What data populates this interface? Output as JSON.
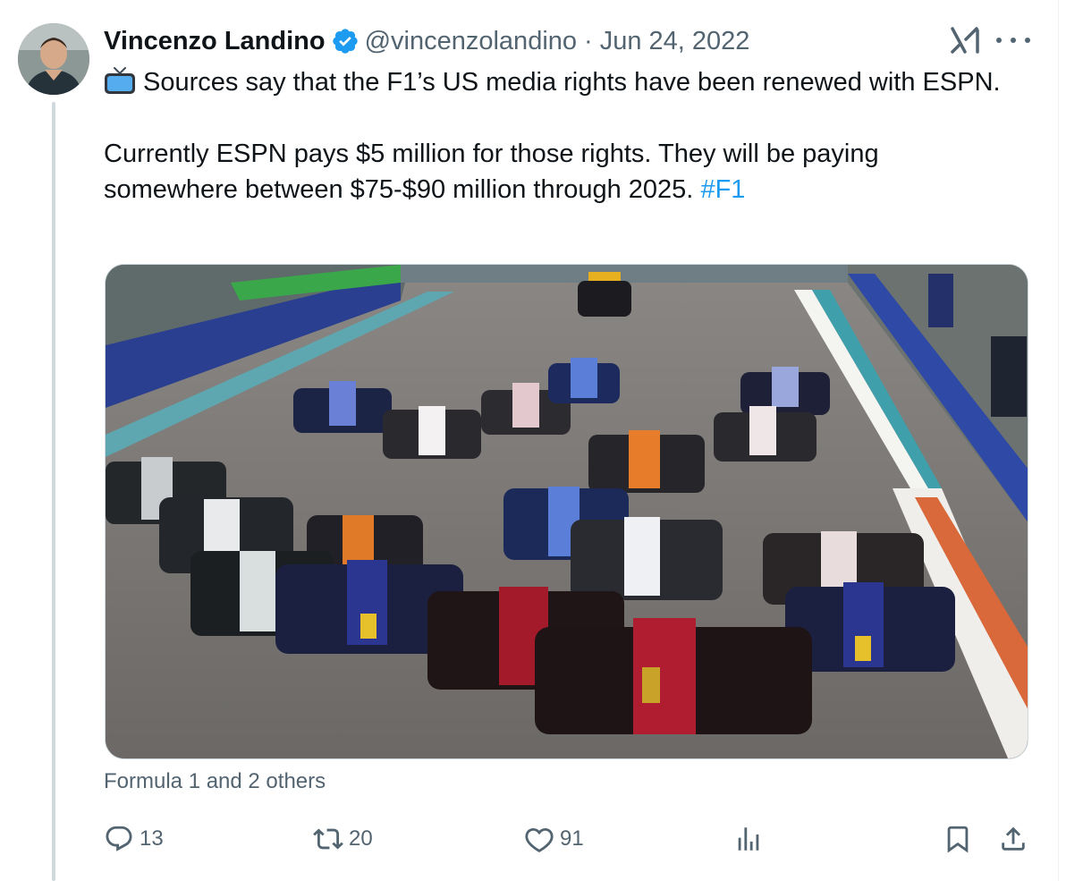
{
  "author": {
    "name": "Vincenzo Landino",
    "handle": "@vincenzolandino",
    "separator": "·",
    "date": "Jun 24, 2022"
  },
  "tweet": {
    "paragraph1": "Sources say that the F1’s US media rights have been renewed with ESPN.",
    "paragraph2": "Currently ESPN pays $5 million for those rights. They will be paying somewhere between $75-$90 million through 2025.",
    "hashtag": "#F1"
  },
  "media": {
    "caption": "Formula 1 and 2 others"
  },
  "actions": {
    "replies": "13",
    "reposts": "20",
    "likes": "91"
  },
  "icons": {
    "verified": "verified-badge-icon",
    "grok": "grok-icon",
    "more": "more-icon",
    "tv": "television-emoji-icon",
    "reply": "reply-icon",
    "repost": "repost-icon",
    "like": "heart-icon",
    "views": "views-icon",
    "bookmark": "bookmark-icon",
    "share": "share-icon"
  },
  "colors": {
    "accent": "#1d9bf0",
    "text": "#0f1419",
    "secondary": "#536471"
  }
}
